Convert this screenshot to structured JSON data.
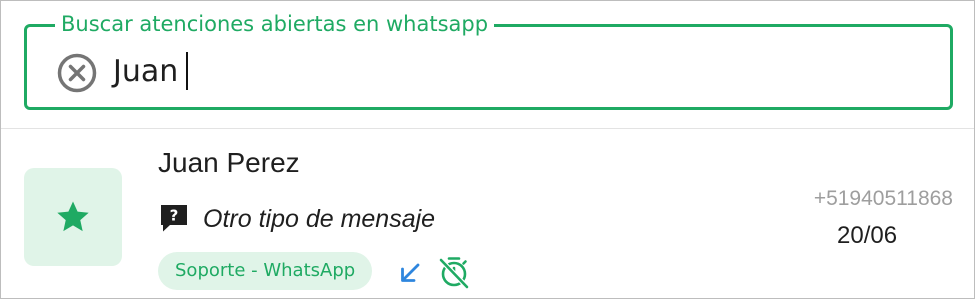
{
  "search": {
    "label": "Buscar atenciones abiertas en whatsapp",
    "value": "Juan"
  },
  "conversation": {
    "name": "Juan Perez",
    "last_message": "Otro tipo de mensaje",
    "channel": "Soporte - WhatsApp",
    "phone": "+51940511868",
    "date": "20/06",
    "favorite": true,
    "direction": "incoming",
    "timer": "off"
  },
  "icons": {
    "clear": "cancel-circle-icon",
    "avatar": "star-icon",
    "message": "message-question-icon",
    "direction": "arrow-down-left-icon",
    "timer": "timer-off-icon"
  },
  "colors": {
    "accent": "#1faa63",
    "accent_light": "#e0f4e8",
    "direction_icon": "#2e86de",
    "muted": "#9e9e9e"
  }
}
